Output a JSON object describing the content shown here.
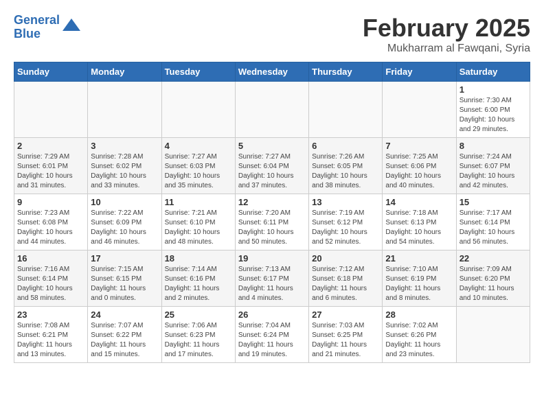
{
  "header": {
    "logo_line1": "General",
    "logo_line2": "Blue",
    "title": "February 2025",
    "subtitle": "Mukharram al Fawqani, Syria"
  },
  "days_of_week": [
    "Sunday",
    "Monday",
    "Tuesday",
    "Wednesday",
    "Thursday",
    "Friday",
    "Saturday"
  ],
  "weeks": [
    [
      {
        "day": "",
        "info": ""
      },
      {
        "day": "",
        "info": ""
      },
      {
        "day": "",
        "info": ""
      },
      {
        "day": "",
        "info": ""
      },
      {
        "day": "",
        "info": ""
      },
      {
        "day": "",
        "info": ""
      },
      {
        "day": "1",
        "info": "Sunrise: 7:30 AM\nSunset: 6:00 PM\nDaylight: 10 hours\nand 29 minutes."
      }
    ],
    [
      {
        "day": "2",
        "info": "Sunrise: 7:29 AM\nSunset: 6:01 PM\nDaylight: 10 hours\nand 31 minutes."
      },
      {
        "day": "3",
        "info": "Sunrise: 7:28 AM\nSunset: 6:02 PM\nDaylight: 10 hours\nand 33 minutes."
      },
      {
        "day": "4",
        "info": "Sunrise: 7:27 AM\nSunset: 6:03 PM\nDaylight: 10 hours\nand 35 minutes."
      },
      {
        "day": "5",
        "info": "Sunrise: 7:27 AM\nSunset: 6:04 PM\nDaylight: 10 hours\nand 37 minutes."
      },
      {
        "day": "6",
        "info": "Sunrise: 7:26 AM\nSunset: 6:05 PM\nDaylight: 10 hours\nand 38 minutes."
      },
      {
        "day": "7",
        "info": "Sunrise: 7:25 AM\nSunset: 6:06 PM\nDaylight: 10 hours\nand 40 minutes."
      },
      {
        "day": "8",
        "info": "Sunrise: 7:24 AM\nSunset: 6:07 PM\nDaylight: 10 hours\nand 42 minutes."
      }
    ],
    [
      {
        "day": "9",
        "info": "Sunrise: 7:23 AM\nSunset: 6:08 PM\nDaylight: 10 hours\nand 44 minutes."
      },
      {
        "day": "10",
        "info": "Sunrise: 7:22 AM\nSunset: 6:09 PM\nDaylight: 10 hours\nand 46 minutes."
      },
      {
        "day": "11",
        "info": "Sunrise: 7:21 AM\nSunset: 6:10 PM\nDaylight: 10 hours\nand 48 minutes."
      },
      {
        "day": "12",
        "info": "Sunrise: 7:20 AM\nSunset: 6:11 PM\nDaylight: 10 hours\nand 50 minutes."
      },
      {
        "day": "13",
        "info": "Sunrise: 7:19 AM\nSunset: 6:12 PM\nDaylight: 10 hours\nand 52 minutes."
      },
      {
        "day": "14",
        "info": "Sunrise: 7:18 AM\nSunset: 6:13 PM\nDaylight: 10 hours\nand 54 minutes."
      },
      {
        "day": "15",
        "info": "Sunrise: 7:17 AM\nSunset: 6:14 PM\nDaylight: 10 hours\nand 56 minutes."
      }
    ],
    [
      {
        "day": "16",
        "info": "Sunrise: 7:16 AM\nSunset: 6:14 PM\nDaylight: 10 hours\nand 58 minutes."
      },
      {
        "day": "17",
        "info": "Sunrise: 7:15 AM\nSunset: 6:15 PM\nDaylight: 11 hours\nand 0 minutes."
      },
      {
        "day": "18",
        "info": "Sunrise: 7:14 AM\nSunset: 6:16 PM\nDaylight: 11 hours\nand 2 minutes."
      },
      {
        "day": "19",
        "info": "Sunrise: 7:13 AM\nSunset: 6:17 PM\nDaylight: 11 hours\nand 4 minutes."
      },
      {
        "day": "20",
        "info": "Sunrise: 7:12 AM\nSunset: 6:18 PM\nDaylight: 11 hours\nand 6 minutes."
      },
      {
        "day": "21",
        "info": "Sunrise: 7:10 AM\nSunset: 6:19 PM\nDaylight: 11 hours\nand 8 minutes."
      },
      {
        "day": "22",
        "info": "Sunrise: 7:09 AM\nSunset: 6:20 PM\nDaylight: 11 hours\nand 10 minutes."
      }
    ],
    [
      {
        "day": "23",
        "info": "Sunrise: 7:08 AM\nSunset: 6:21 PM\nDaylight: 11 hours\nand 13 minutes."
      },
      {
        "day": "24",
        "info": "Sunrise: 7:07 AM\nSunset: 6:22 PM\nDaylight: 11 hours\nand 15 minutes."
      },
      {
        "day": "25",
        "info": "Sunrise: 7:06 AM\nSunset: 6:23 PM\nDaylight: 11 hours\nand 17 minutes."
      },
      {
        "day": "26",
        "info": "Sunrise: 7:04 AM\nSunset: 6:24 PM\nDaylight: 11 hours\nand 19 minutes."
      },
      {
        "day": "27",
        "info": "Sunrise: 7:03 AM\nSunset: 6:25 PM\nDaylight: 11 hours\nand 21 minutes."
      },
      {
        "day": "28",
        "info": "Sunrise: 7:02 AM\nSunset: 6:26 PM\nDaylight: 11 hours\nand 23 minutes."
      },
      {
        "day": "",
        "info": ""
      }
    ]
  ]
}
